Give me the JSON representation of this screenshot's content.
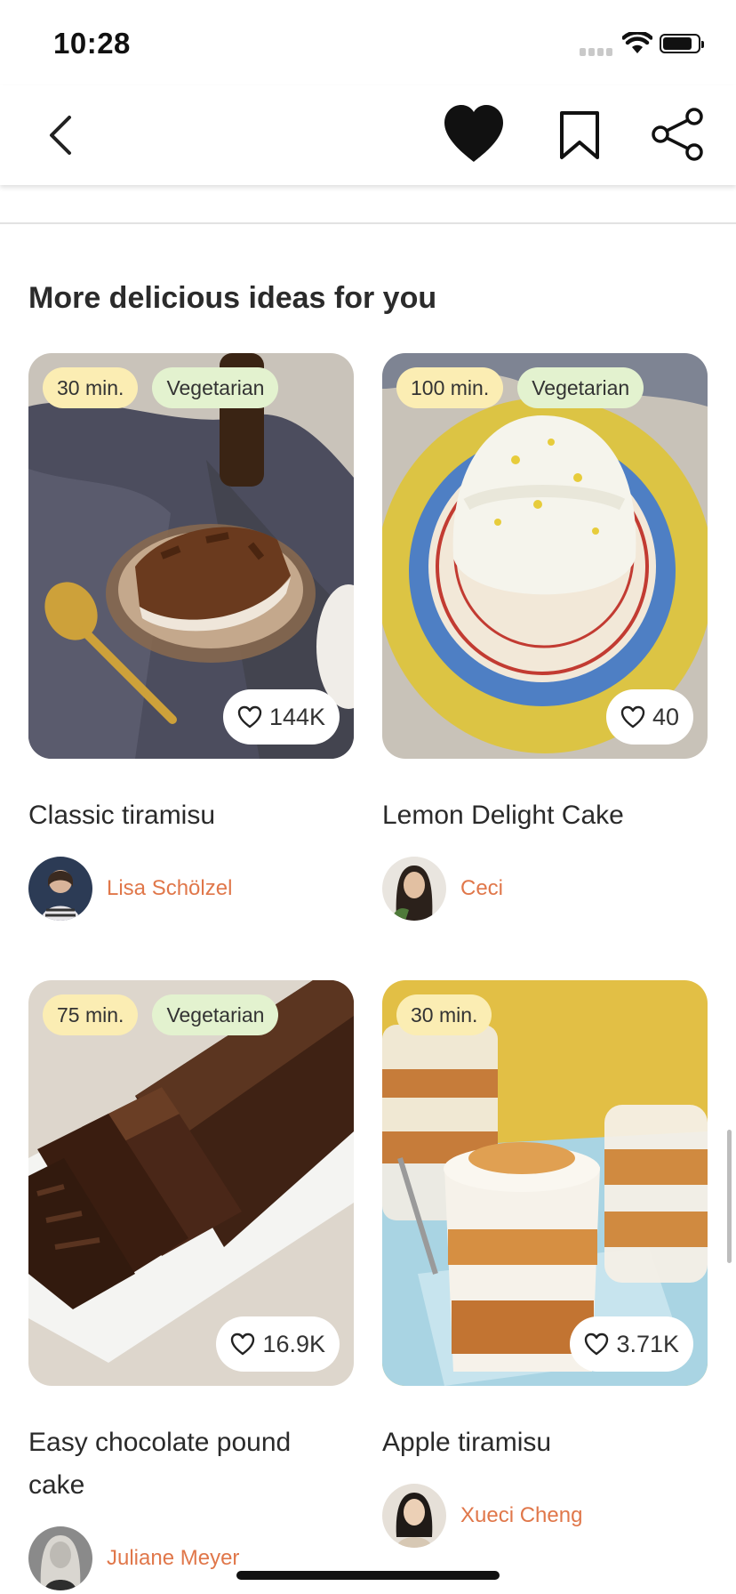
{
  "status": {
    "time": "10:28"
  },
  "section_title": "More delicious ideas for you",
  "cards": [
    {
      "time": "30 min.",
      "veg": "Vegetarian",
      "likes": "144K",
      "title": "Classic tiramisu",
      "author": "Lisa Schölzel"
    },
    {
      "time": "100 min.",
      "veg": "Vegetarian",
      "likes": "40",
      "title": "Lemon Delight Cake",
      "author": "Ceci"
    },
    {
      "time": "75 min.",
      "veg": "Vegetarian",
      "likes": "16.9K",
      "title": "Easy chocolate pound cake",
      "author": "Juliane Meyer"
    },
    {
      "time": "30 min.",
      "likes": "3.71K",
      "title": "Apple tiramisu",
      "author": "Xueci Cheng"
    }
  ],
  "icons": {
    "back": "chevron-left-icon",
    "favorite": "heart-filled-icon",
    "bookmark": "bookmark-icon",
    "share": "share-icon",
    "like": "heart-outline-icon"
  },
  "colors": {
    "author_name": "#e0774a",
    "time_tag": "#fbedb3",
    "vegetarian_tag": "#e3f2cf"
  }
}
